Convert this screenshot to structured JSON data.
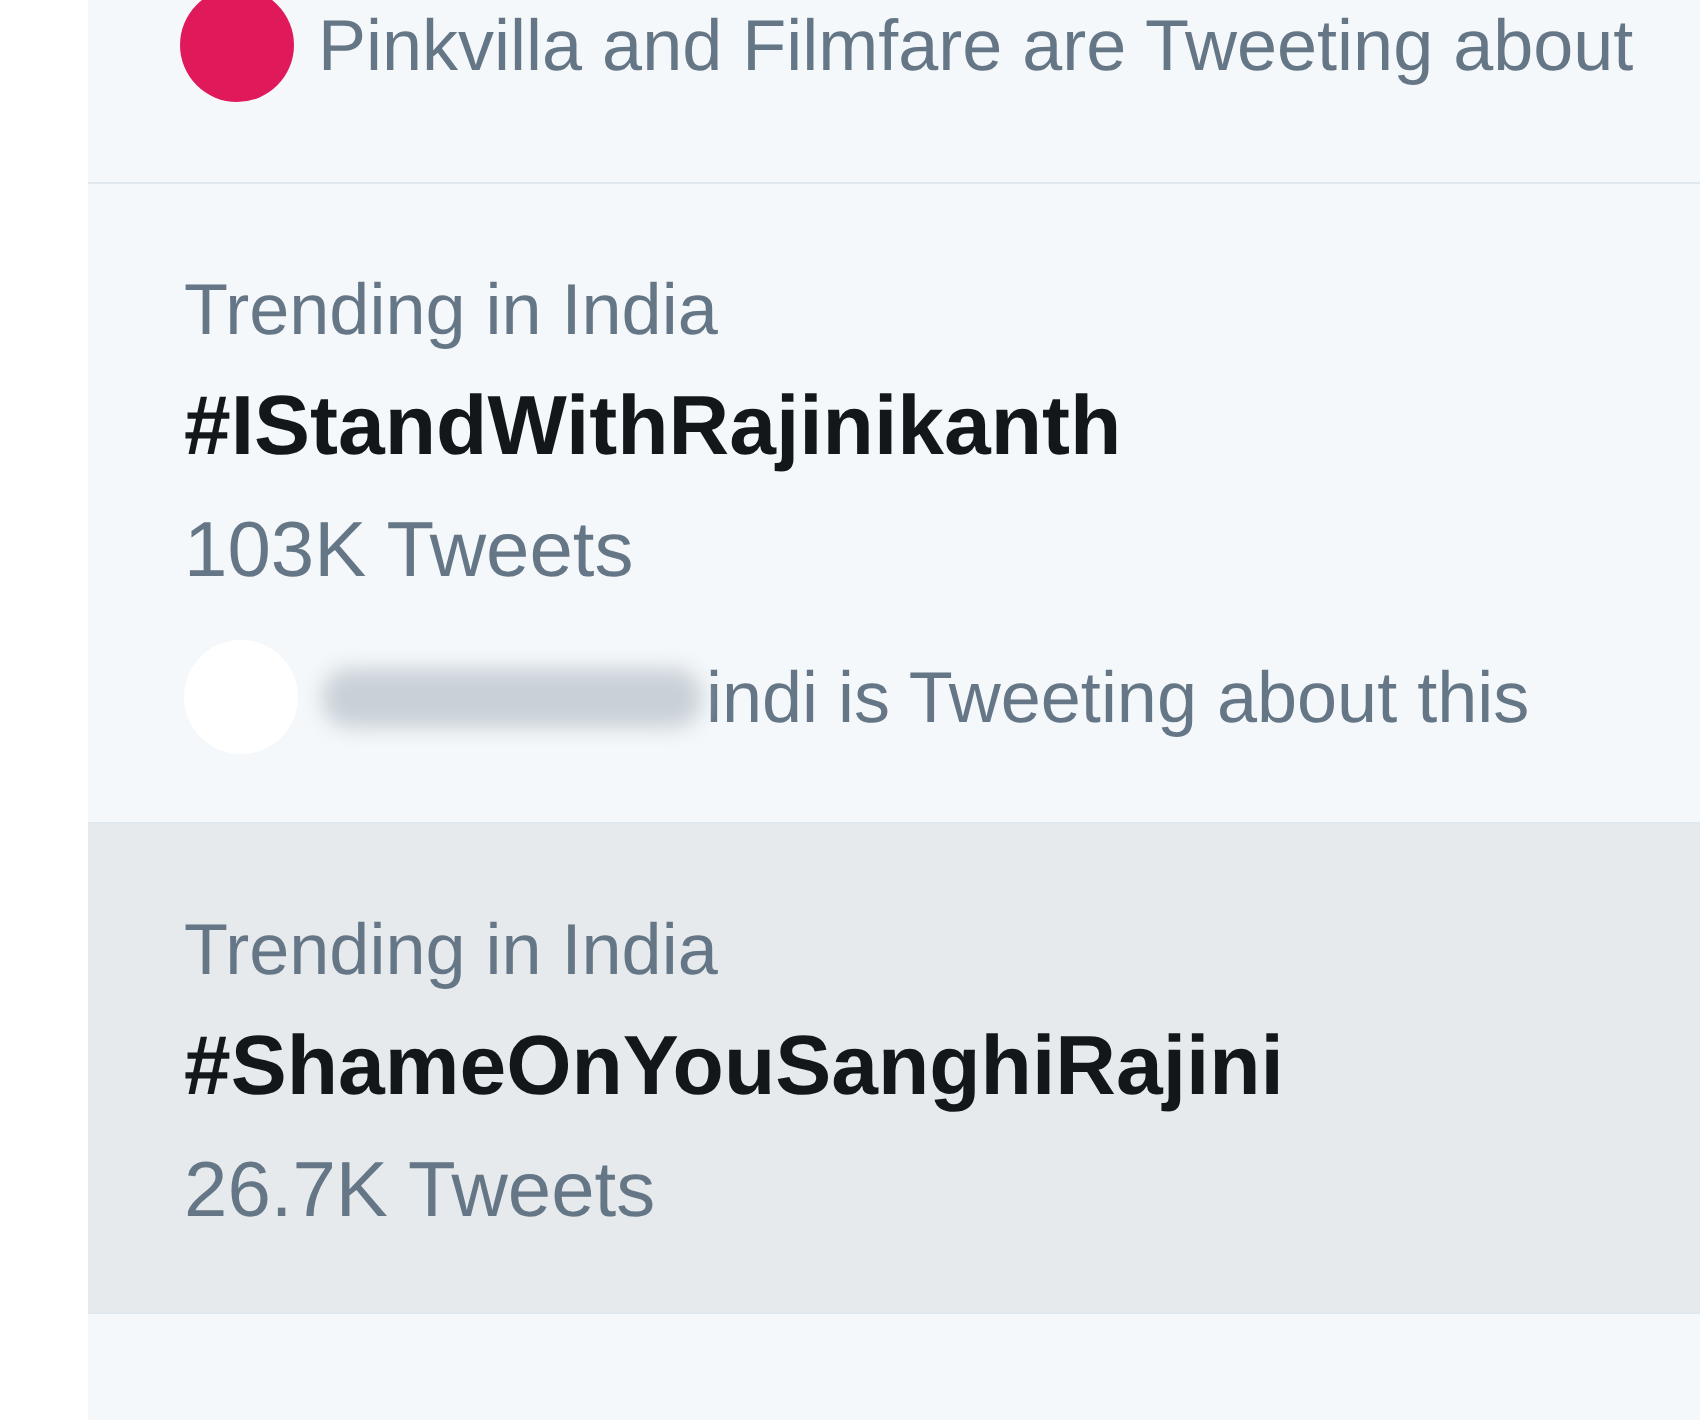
{
  "trends": [
    {
      "hovered": false,
      "context": {
        "color": "#e0195a",
        "blurred": false,
        "text": "Pinkvilla and Filmfare are Tweeting about"
      }
    },
    {
      "hovered": false,
      "location": "Trending in India",
      "hashtag": "#IStandWithRajinikanth",
      "count": "103K Tweets",
      "context": {
        "color": "#ffffff",
        "blurred": true,
        "text": "indi is Tweeting about this"
      }
    },
    {
      "hovered": true,
      "location": "Trending in India",
      "hashtag": "#ShameOnYouSanghiRajini",
      "count": "26.7K Tweets"
    }
  ]
}
